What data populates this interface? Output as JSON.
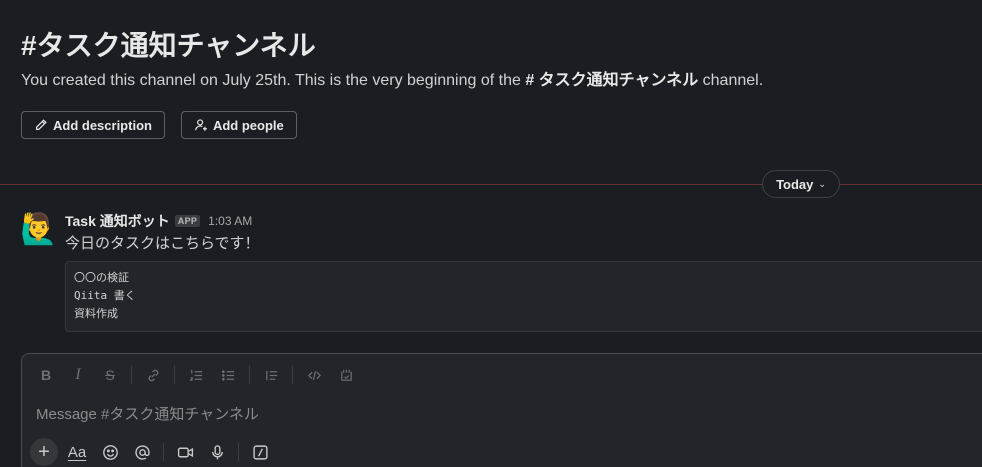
{
  "channel": {
    "title": "#タスク通知チャンネル",
    "intro_prefix": "You created this channel on July 25th. This is the very beginning of the ",
    "intro_channel": "# タスク通知チャンネル",
    "intro_suffix": " channel.",
    "add_description_label": "Add description",
    "add_people_label": "Add people"
  },
  "divider": {
    "day_label": "Today"
  },
  "message": {
    "avatar_emoji": "🙋‍♂️",
    "sender": "Task 通知ボット",
    "badge": "APP",
    "time": "1:03 AM",
    "text": "今日のタスクはこちらです！",
    "code_lines": [
      "〇〇の検証",
      "Qiita 書く",
      "資料作成"
    ]
  },
  "composer": {
    "placeholder": "Message #タスク通知チャンネル",
    "format_tools": [
      "bold-icon",
      "italic-icon",
      "strikethrough-icon",
      "link-icon",
      "ordered-list-icon",
      "bulleted-list-icon",
      "blockquote-icon",
      "code-icon",
      "code-block-icon"
    ],
    "actions": [
      "plus-icon",
      "text-format-icon",
      "emoji-icon",
      "mention-icon",
      "video-icon",
      "microphone-icon",
      "slash-command-icon"
    ],
    "aa_label": "Aa",
    "plus_label": "+"
  },
  "colors": {
    "background": "#1a1d21",
    "divider_line": "#6a2f33",
    "text_primary": "#e8e8e8",
    "text_secondary": "#d1d2d3"
  }
}
